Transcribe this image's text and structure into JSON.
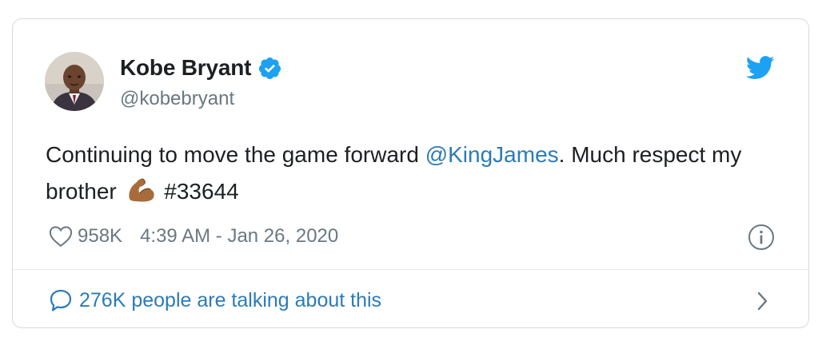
{
  "author": {
    "display_name": "Kobe Bryant",
    "handle": "@kobebryant",
    "verified": true,
    "avatar_icon": "avatar-portrait"
  },
  "tweet": {
    "text_part1": "Continuing to move the game forward ",
    "mention": "@KingJames",
    "text_part2": ". Much respect my brother ",
    "emoji": "flexed-biceps",
    "hashtag": "#33644"
  },
  "meta": {
    "likes": "958K",
    "timestamp": "4:39 AM - Jan 26, 2020"
  },
  "footer": {
    "conversation_label": "276K people are talking about this"
  },
  "colors": {
    "link": "#2b7bb9",
    "twitter_blue": "#1da1f2",
    "muted": "#697882",
    "text": "#1c2022",
    "border": "#d6dadd"
  },
  "icons": [
    "verified-badge-icon",
    "twitter-bird-icon",
    "heart-icon",
    "info-icon",
    "chat-bubble-icon",
    "chevron-right-icon"
  ]
}
